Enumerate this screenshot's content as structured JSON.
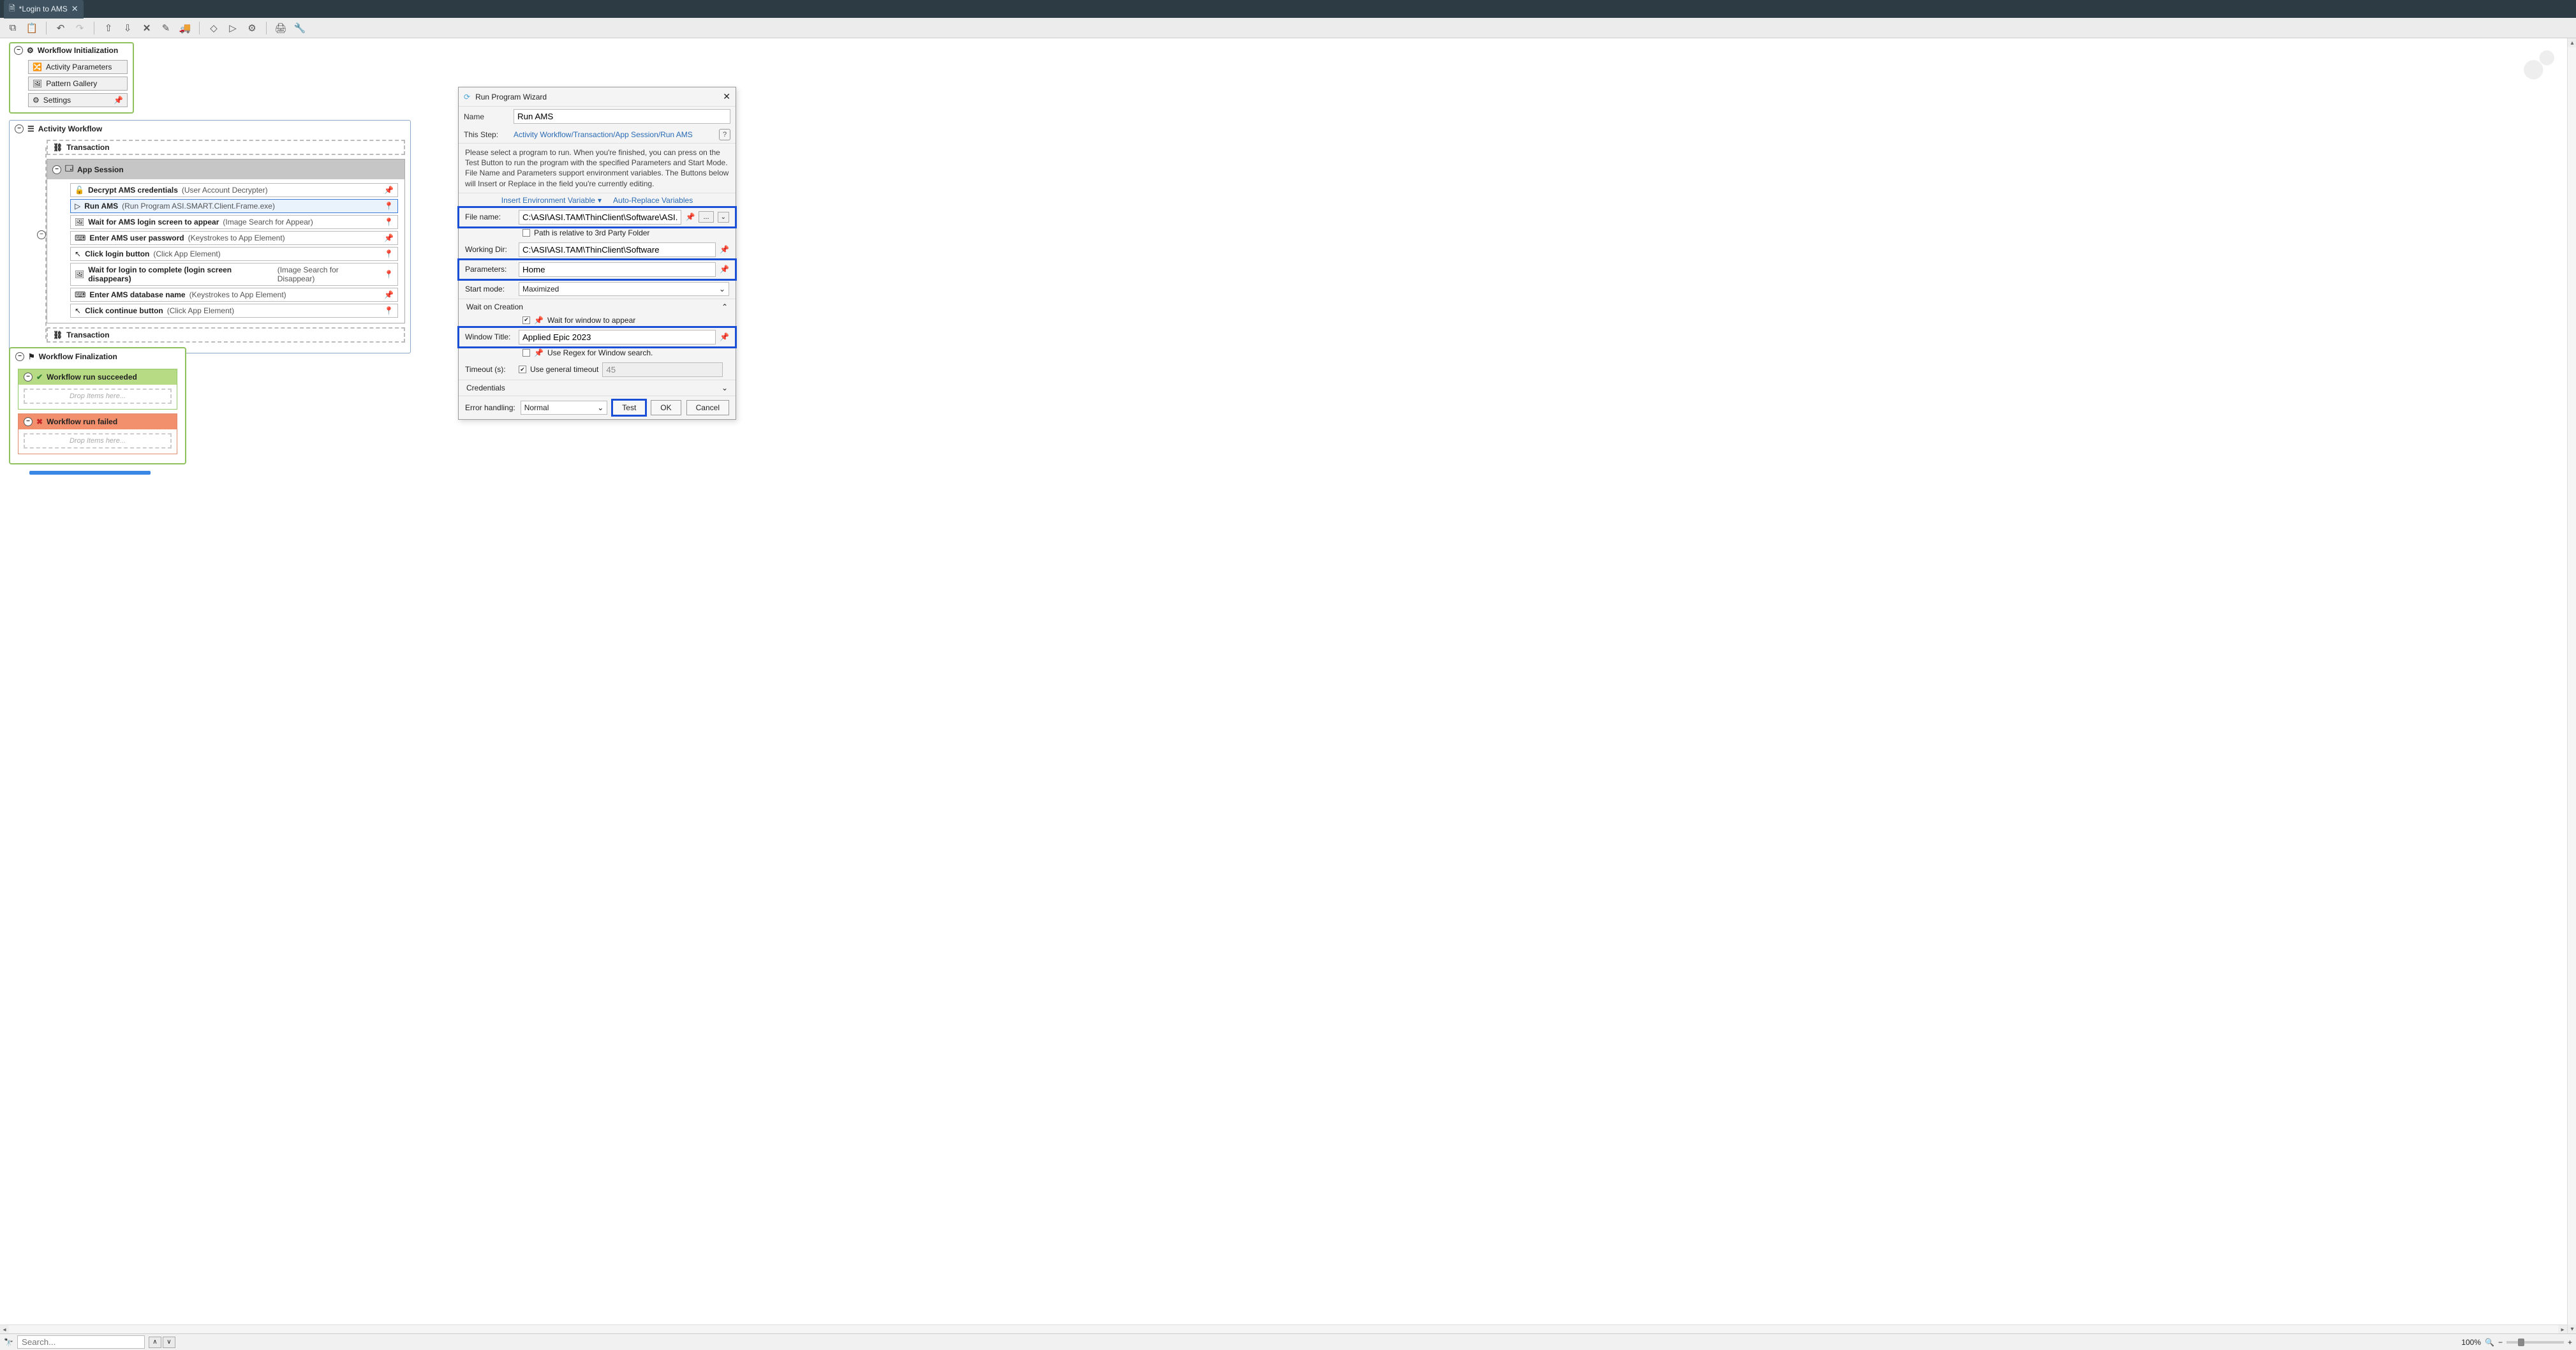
{
  "tab": {
    "title": "*Login to AMS"
  },
  "wfInit": {
    "title": "Workflow Initialization",
    "items": [
      "Activity Parameters",
      "Pattern Gallery",
      "Settings"
    ]
  },
  "activity": {
    "title": "Activity Workflow",
    "transactionLabel": "Transaction",
    "appSessionLabel": "App Session",
    "steps": [
      {
        "name": "Decrypt AMS credentials",
        "note": "(User Account Decrypter)",
        "selected": false,
        "pinFilled": true
      },
      {
        "name": "Run AMS",
        "note": "(Run Program ASI.SMART.Client.Frame.exe)",
        "selected": true,
        "pinFilled": false
      },
      {
        "name": "Wait for AMS login screen to appear",
        "note": "(Image Search for Appear)",
        "selected": false,
        "pinFilled": false
      },
      {
        "name": "Enter AMS user password",
        "note": "(Keystrokes to App Element)",
        "selected": false,
        "pinFilled": true
      },
      {
        "name": "Click login button",
        "note": "(Click App Element)",
        "selected": false,
        "pinFilled": false
      },
      {
        "name": "Wait for login to complete (login screen disappears)",
        "note": "(Image Search for Disappear)",
        "selected": false,
        "pinFilled": false
      },
      {
        "name": "Enter AMS database name",
        "note": "(Keystrokes to App Element)",
        "selected": false,
        "pinFilled": true
      },
      {
        "name": "Click continue button",
        "note": "(Click App Element)",
        "selected": false,
        "pinFilled": false
      }
    ]
  },
  "final": {
    "title": "Workflow Finalization",
    "succeeded": "Workflow run succeeded",
    "failed": "Workflow run failed",
    "dropText": "Drop Items here..."
  },
  "dialog": {
    "title": "Run Program Wizard",
    "nameLabel": "Name",
    "nameValue": "Run AMS",
    "stepLabel": "This Step:",
    "stepPath": "Activity Workflow/Transaction/App Session/Run AMS",
    "desc": "Please select a program to run. When you're finished, you can press on the Test Button to run the program with the specified Parameters and Start Mode.\nFile Name and Parameters support environment variables. The Buttons below will Insert or Replace in the field you're currently editing.",
    "insertEnv": "Insert Environment Variable",
    "autoReplace": "Auto-Replace Variables",
    "fileLabel": "File name:",
    "fileValue": "C:\\ASI\\ASI.TAM\\ThinClient\\Software\\ASI.SMART.Client.Frame.e",
    "browse": "...",
    "relPath": "Path is relative to 3rd Party Folder",
    "workLabel": "Working Dir:",
    "workValue": "C:\\ASI\\ASI.TAM\\ThinClient\\Software",
    "paramLabel": "Parameters:",
    "paramValue": "Home",
    "startLabel": "Start mode:",
    "startValue": "Maximized",
    "waitCreation": "Wait on Creation",
    "waitWindow": "Wait for window to appear",
    "winTitleLabel": "Window Title:",
    "winTitleValue": "Applied Epic 2023",
    "useRegex": "Use Regex for Window search.",
    "timeoutLabel": "Timeout (s):",
    "useGeneral": "Use general timeout",
    "timeoutValue": "45",
    "credentials": "Credentials",
    "errLabel": "Error handling:",
    "errValue": "Normal",
    "test": "Test",
    "ok": "OK",
    "cancel": "Cancel"
  },
  "status": {
    "searchPlaceholder": "Search...",
    "zoom": "100%"
  }
}
